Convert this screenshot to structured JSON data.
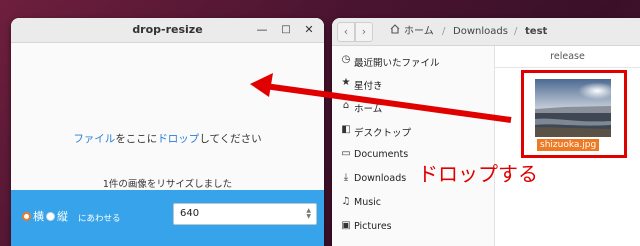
{
  "app_window": {
    "title": "drop-resize",
    "controls": {
      "minimize": "—",
      "maximize": "□",
      "close": "✕"
    },
    "drop_message": {
      "part1": "ファイル",
      "part2": "をここに",
      "part3": "ドロップ",
      "part4": "してください"
    },
    "status": "1件の画像をリサイズしました",
    "orientation": {
      "horizontal": "横",
      "vertical": "縦",
      "selected": "横"
    },
    "fit_label": "にあわせる",
    "size_value": "640"
  },
  "file_manager": {
    "path": {
      "home": "ホーム",
      "sep1": "/",
      "downloads": "Downloads",
      "sep2": "/",
      "current": "test"
    },
    "sidebar": [
      {
        "icon": "recent-icon",
        "label": "最近開いたファイル"
      },
      {
        "icon": "star-icon",
        "label": "星付き"
      },
      {
        "icon": "home-icon",
        "label": "ホーム"
      },
      {
        "icon": "desktop-icon",
        "label": "デスクトップ"
      },
      {
        "icon": "folder-icon",
        "label": "Documents"
      },
      {
        "icon": "download-icon",
        "label": "Downloads"
      },
      {
        "icon": "music-icon",
        "label": "Music"
      },
      {
        "icon": "camera-icon",
        "label": "Pictures"
      }
    ],
    "column_header": "release",
    "file": {
      "name": "shizuoka.jpg"
    }
  },
  "annotation": {
    "text": "ドロップする",
    "color": "#e00000"
  },
  "colors": {
    "accent_blue": "#36a3ea",
    "selection_orange": "#f07a24",
    "link_blue": "#2a7fd4"
  }
}
